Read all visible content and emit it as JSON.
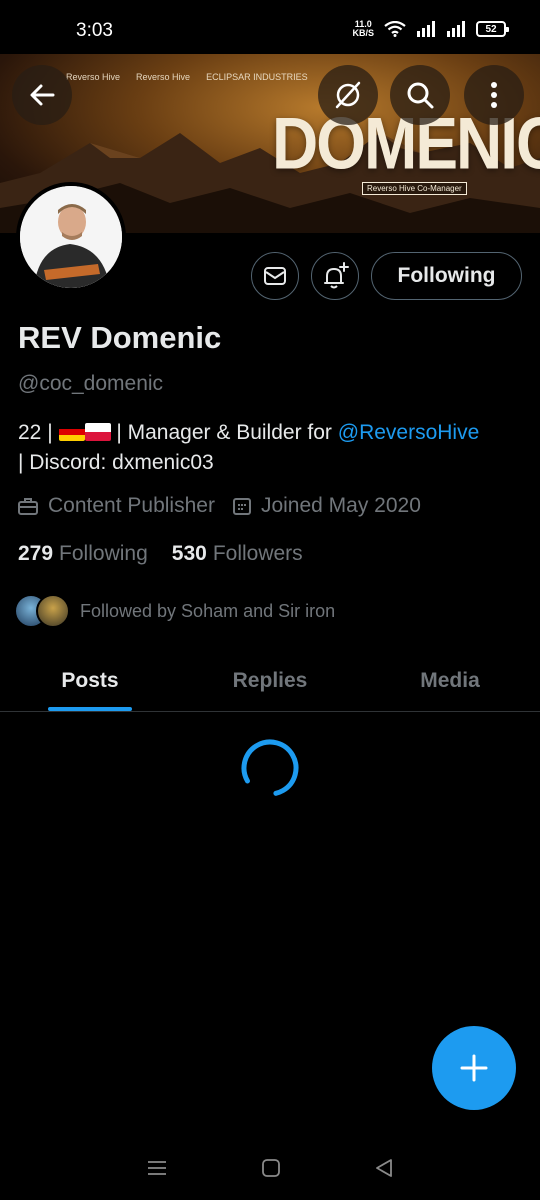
{
  "status_bar": {
    "time": "3:03",
    "net_speed_value": "11.0",
    "net_speed_unit": "KB/S",
    "battery": "52"
  },
  "banner": {
    "brands": [
      "Reverso Hive",
      "Reverso Hive",
      "ECLIPSAR INDUSTRIES"
    ],
    "title": "DOMENIC",
    "subtitle": "Reverso Hive Co-Manager"
  },
  "header_actions": {
    "back_icon": "arrow-left-icon",
    "grok_icon": "grok-icon",
    "search_icon": "search-icon",
    "more_icon": "more-vertical-icon"
  },
  "profile_actions": {
    "message_icon": "envelope-icon",
    "notify_icon": "bell-plus-icon",
    "following_label": "Following"
  },
  "profile": {
    "display_name": "REV Domenic",
    "handle": "@coc_domenic",
    "bio_prefix": "22 |",
    "bio_middle": "| Manager & Builder for",
    "bio_link": "@ReversoHive",
    "bio_suffix": "| Discord: dxmenic03",
    "category": "Content Publisher",
    "joined": "Joined May 2020",
    "following_count": "279",
    "following_label": "Following",
    "followers_count": "530",
    "followers_label": "Followers",
    "followed_by": "Followed by Soham and Sir iron"
  },
  "tabs": [
    {
      "label": "Posts",
      "active": true
    },
    {
      "label": "Replies",
      "active": false
    },
    {
      "label": "Media",
      "active": false
    }
  ],
  "colors": {
    "accent": "#1d9bf0",
    "background": "#000000",
    "muted": "#71767b"
  }
}
